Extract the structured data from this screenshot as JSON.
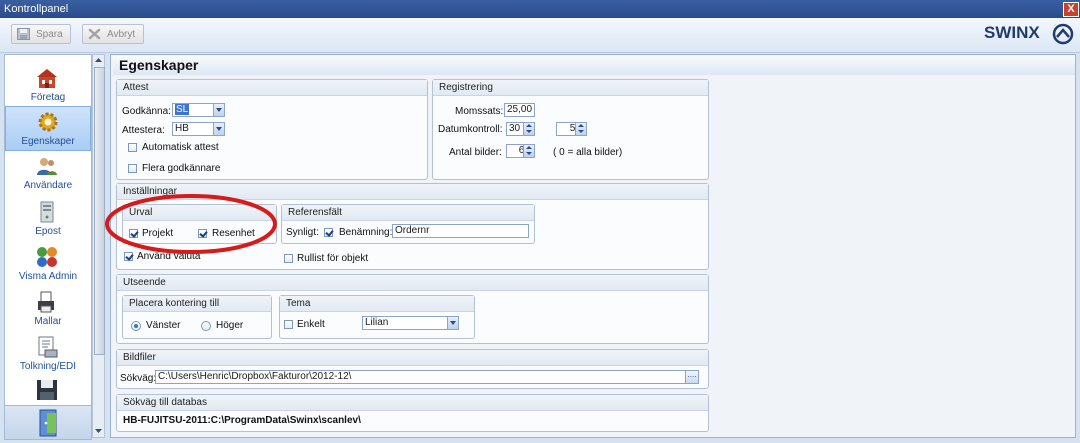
{
  "window": {
    "title": "Kontrollpanel",
    "close_glyph": "X"
  },
  "toolbar": {
    "save_label": "Spara",
    "cancel_label": "Avbryt"
  },
  "brand": {
    "logo_text": "SWINX"
  },
  "sidebar": {
    "items": [
      {
        "label": "Företag"
      },
      {
        "label": "Egenskaper"
      },
      {
        "label": "Användare"
      },
      {
        "label": "Epost"
      },
      {
        "label": "Visma Admin"
      },
      {
        "label": "Mallar"
      },
      {
        "label": "Tolkning/EDI"
      }
    ]
  },
  "page": {
    "title": "Egenskaper"
  },
  "attest": {
    "header": "Attest",
    "godkanna_label": "Godkänna:",
    "godkanna_value": "SL",
    "attestera_label": "Attestera:",
    "attestera_value": "HB",
    "auto_label": "Automatisk attest",
    "flera_label": "Flera godkännare"
  },
  "registrering": {
    "header": "Registrering",
    "moms_label": "Momssats:",
    "moms_value": "25,00",
    "datum_label": "Datumkontroll:",
    "datum_value1": "30",
    "datum_value2": "5",
    "bilder_label": "Antal bilder:",
    "bilder_value": "6",
    "bilder_hint": "( 0 = alla bilder)"
  },
  "installningar": {
    "header": "Inställningar",
    "urval_header": "Urval",
    "projekt_label": "Projekt",
    "resenhet_label": "Resenhet",
    "valuta_label": "Använd valuta",
    "ref_header": "Referensfält",
    "synligt_label": "Synligt:",
    "benamning_label": "Benämning:",
    "benamning_value": "Ordernr",
    "rullist_label": "Rullist för objekt"
  },
  "utseende": {
    "header": "Utseende",
    "placera_header": "Placera kontering till",
    "vanster_label": "Vänster",
    "hoger_label": "Höger",
    "tema_header": "Tema",
    "enkelt_label": "Enkelt",
    "tema_value": "Lilian"
  },
  "bildfiler": {
    "header": "Bildfiler",
    "sokvag_label": "Sökväg:",
    "sokvag_value": "C:\\Users\\Henric\\Dropbox\\Fakturor\\2012-12\\",
    "browse_glyph": "...."
  },
  "databas": {
    "header": "Sökväg till databas",
    "value": "HB-FUJITSU-2011:C:\\ProgramData\\Swinx\\scanlev\\"
  },
  "colors": {
    "highlight_ring": "#d61b1b",
    "accent": "#1f4f9a"
  }
}
